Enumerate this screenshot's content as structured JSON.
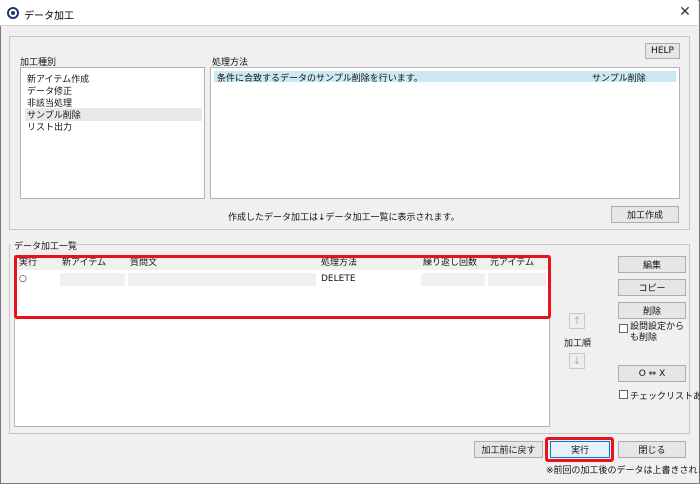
{
  "window": {
    "title": "データ加工",
    "close_glyph": "✕"
  },
  "top_panel": {
    "processing_type_label": "加工種別",
    "processing_types": [
      "新アイテム作成",
      "データ修正",
      "非該当処理",
      "サンプル削除",
      "リスト出力"
    ],
    "selected_type_index": 3,
    "method_label": "処理方法",
    "method_rows": [
      {
        "description": "条件に合致するデータのサンプル削除を行います。",
        "name": "サンプル削除"
      }
    ],
    "help_button": "HELP",
    "info_text": "作成したデータ加工は↓データ加工一覧に表示されます。",
    "create_button": "加工作成"
  },
  "list_section": {
    "title": "データ加工一覧",
    "columns": [
      "実行",
      "新アイテム",
      "質問文",
      "処理方法",
      "繰り返し回数",
      "元アイテム"
    ],
    "rows": [
      {
        "exec": "○",
        "new_item": "",
        "question": "",
        "method": "DELETE",
        "repeat": "",
        "source_item": ""
      }
    ]
  },
  "side_buttons": {
    "edit": "編集",
    "copy": "コピー",
    "delete": "削除",
    "delete_from_settings_label": "設問設定からも削除",
    "order_label": "加工順",
    "up_glyph": "↑",
    "down_glyph": "↓",
    "o_to_x": "O ⇔ X",
    "checklist_label": "チェックリストあり"
  },
  "footer": {
    "revert_button": "加工前に戻す",
    "execute_button": "実行",
    "close_button": "閉じる",
    "note": "※前回の加工後のデータは上書きされます。"
  },
  "colors": {
    "highlight_red": "#e8121c",
    "selection_blue": "#cce8f4"
  }
}
